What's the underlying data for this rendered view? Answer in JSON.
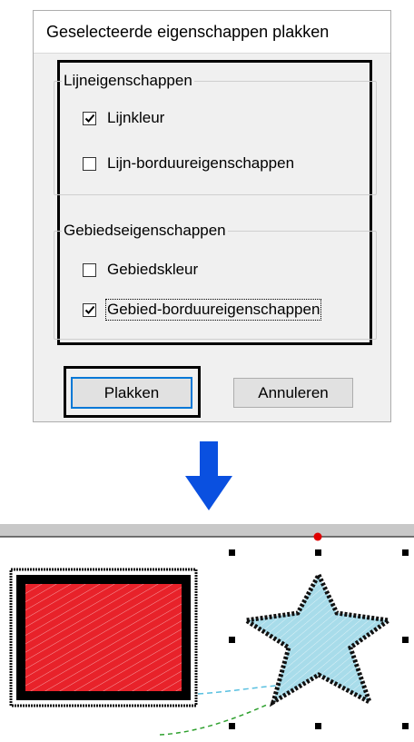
{
  "dialog": {
    "title": "Geselecteerde eigenschappen plakken",
    "line_group": {
      "legend": "Lijneigenschappen",
      "items": [
        {
          "label": "Lijnkleur",
          "checked": true
        },
        {
          "label": "Lijn-borduureigenschappen",
          "checked": false
        }
      ]
    },
    "area_group": {
      "legend": "Gebiedseigenschappen",
      "items": [
        {
          "label": "Gebiedskleur",
          "checked": false
        },
        {
          "label": "Gebied-borduureigenschappen",
          "checked": true
        }
      ]
    },
    "buttons": {
      "paste": "Plakken",
      "cancel": "Annuleren"
    }
  },
  "colors": {
    "arrow": "#0a50e0",
    "rect_fill": "#e8222a",
    "star_fill": "#a8dcea",
    "handle": "#000000",
    "rotation_handle": "#e00000"
  },
  "icons": [
    "arrow-down-icon",
    "checkmark-icon"
  ]
}
